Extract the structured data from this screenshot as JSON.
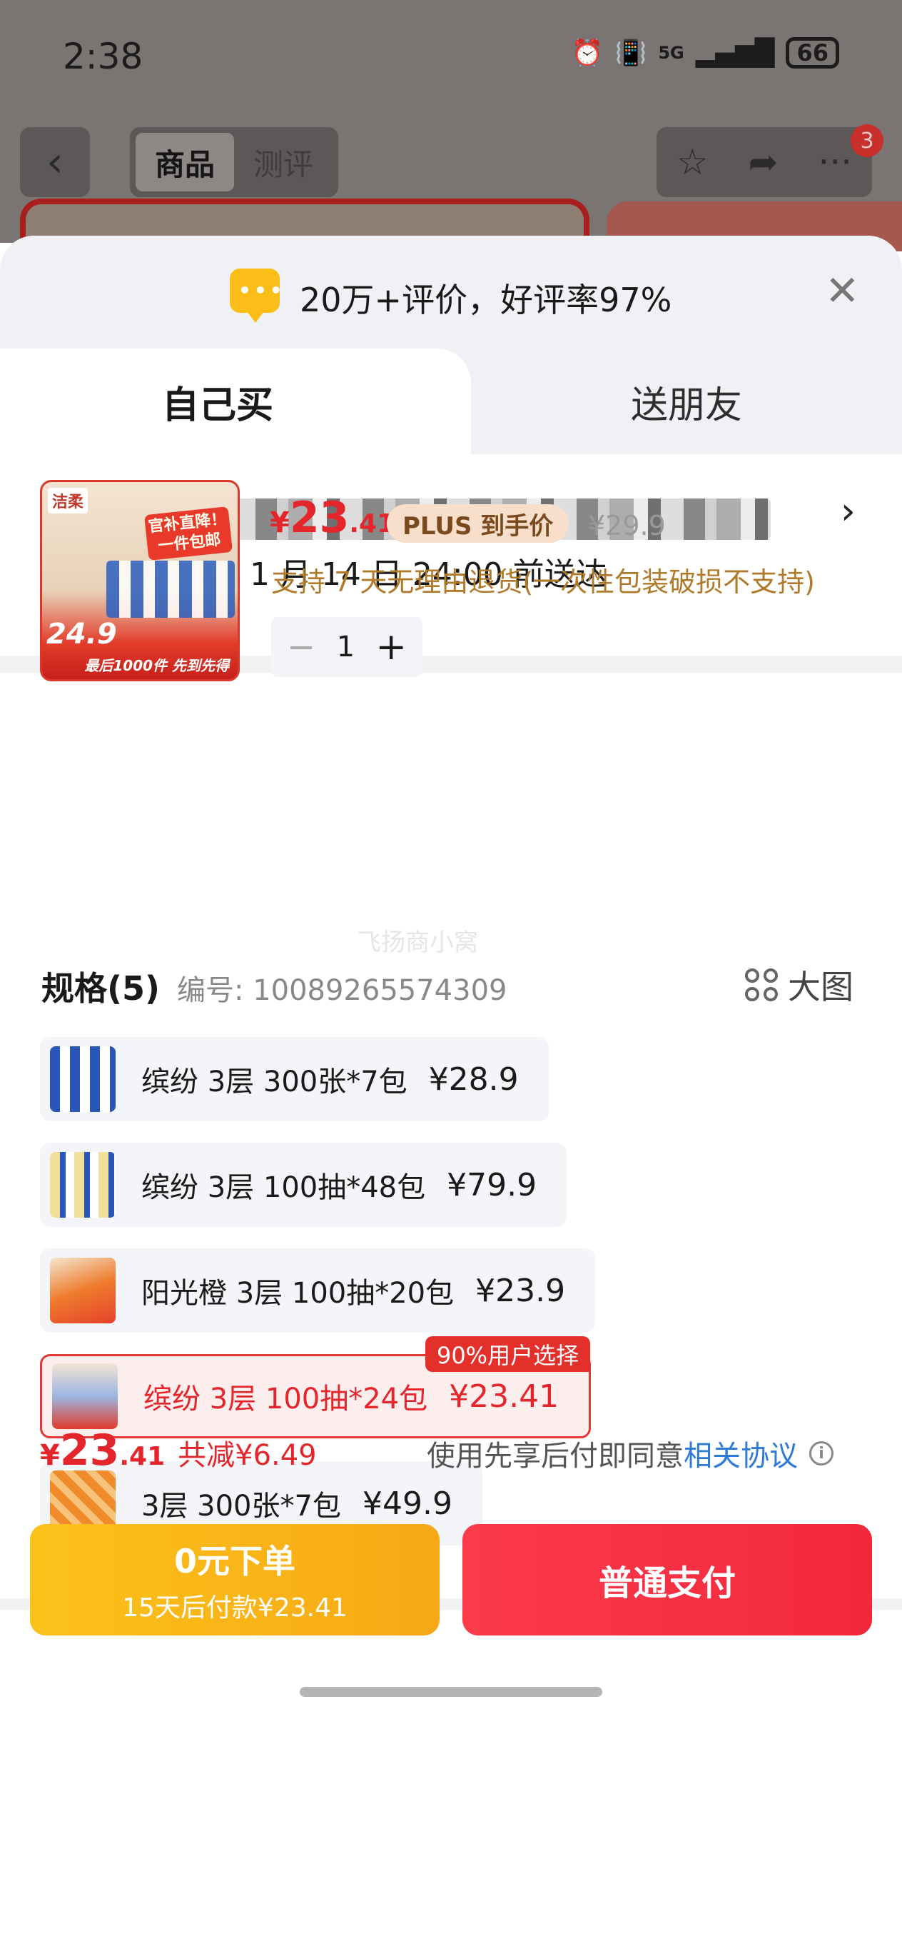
{
  "status_bar": {
    "time": "2:38",
    "network": "5G",
    "battery": "66"
  },
  "background": {
    "tabs": [
      "商品",
      "测评"
    ],
    "notification_count": "3"
  },
  "rating_bar": {
    "text": "20万+评价，好评率97%"
  },
  "buy_tabs": {
    "self": "自己买",
    "friend": "送朋友"
  },
  "delivery": {
    "text": "快递运输 预计 1 月 14 日 24:00 前送达"
  },
  "product": {
    "price_symbol": "¥",
    "price_int": "23",
    "price_dec": ".41",
    "plus_label": "PLUS 到手价",
    "original_price": "¥29.9",
    "return_policy": "支持 7 天无理由退货(一次性包装破损不支持)",
    "quantity": "1",
    "thumb": {
      "brand": "洁柔",
      "tag": "官补直降！一件包邮",
      "price": "24.9",
      "bottom": "最后1000件 先到先得"
    }
  },
  "watermark": "飞扬商小窝",
  "spec": {
    "title": "规格(5)",
    "code": "编号: 10089265574309",
    "big_pic": "大图",
    "items": [
      {
        "name": "缤纷 3层 300张*7包",
        "price": "¥28.9"
      },
      {
        "name": "缤纷 3层 100抽*48包",
        "price": "¥79.9"
      },
      {
        "name": "阳光橙 3层 100抽*20包",
        "price": "¥23.9"
      },
      {
        "name": "缤纷 3层 100抽*24包",
        "price": "¥23.41",
        "tag": "90%用户选择"
      },
      {
        "name": "3层 300张*7包",
        "price": "¥49.9"
      }
    ]
  },
  "footer": {
    "price_symbol": "¥",
    "price_int": "23",
    "price_dec": ".41",
    "reduce": "共减¥6.49",
    "agreement_prefix": "使用先享后付即同意",
    "agreement_link": "相关协议",
    "zero_btn_line1": "0元下单",
    "zero_btn_line2": "15天后付款¥23.41",
    "pay_btn": "普通支付"
  },
  "colors": {
    "accent_red": "#e4252b",
    "yellow": "#fcc21a",
    "link_blue": "#2e7ad6"
  }
}
